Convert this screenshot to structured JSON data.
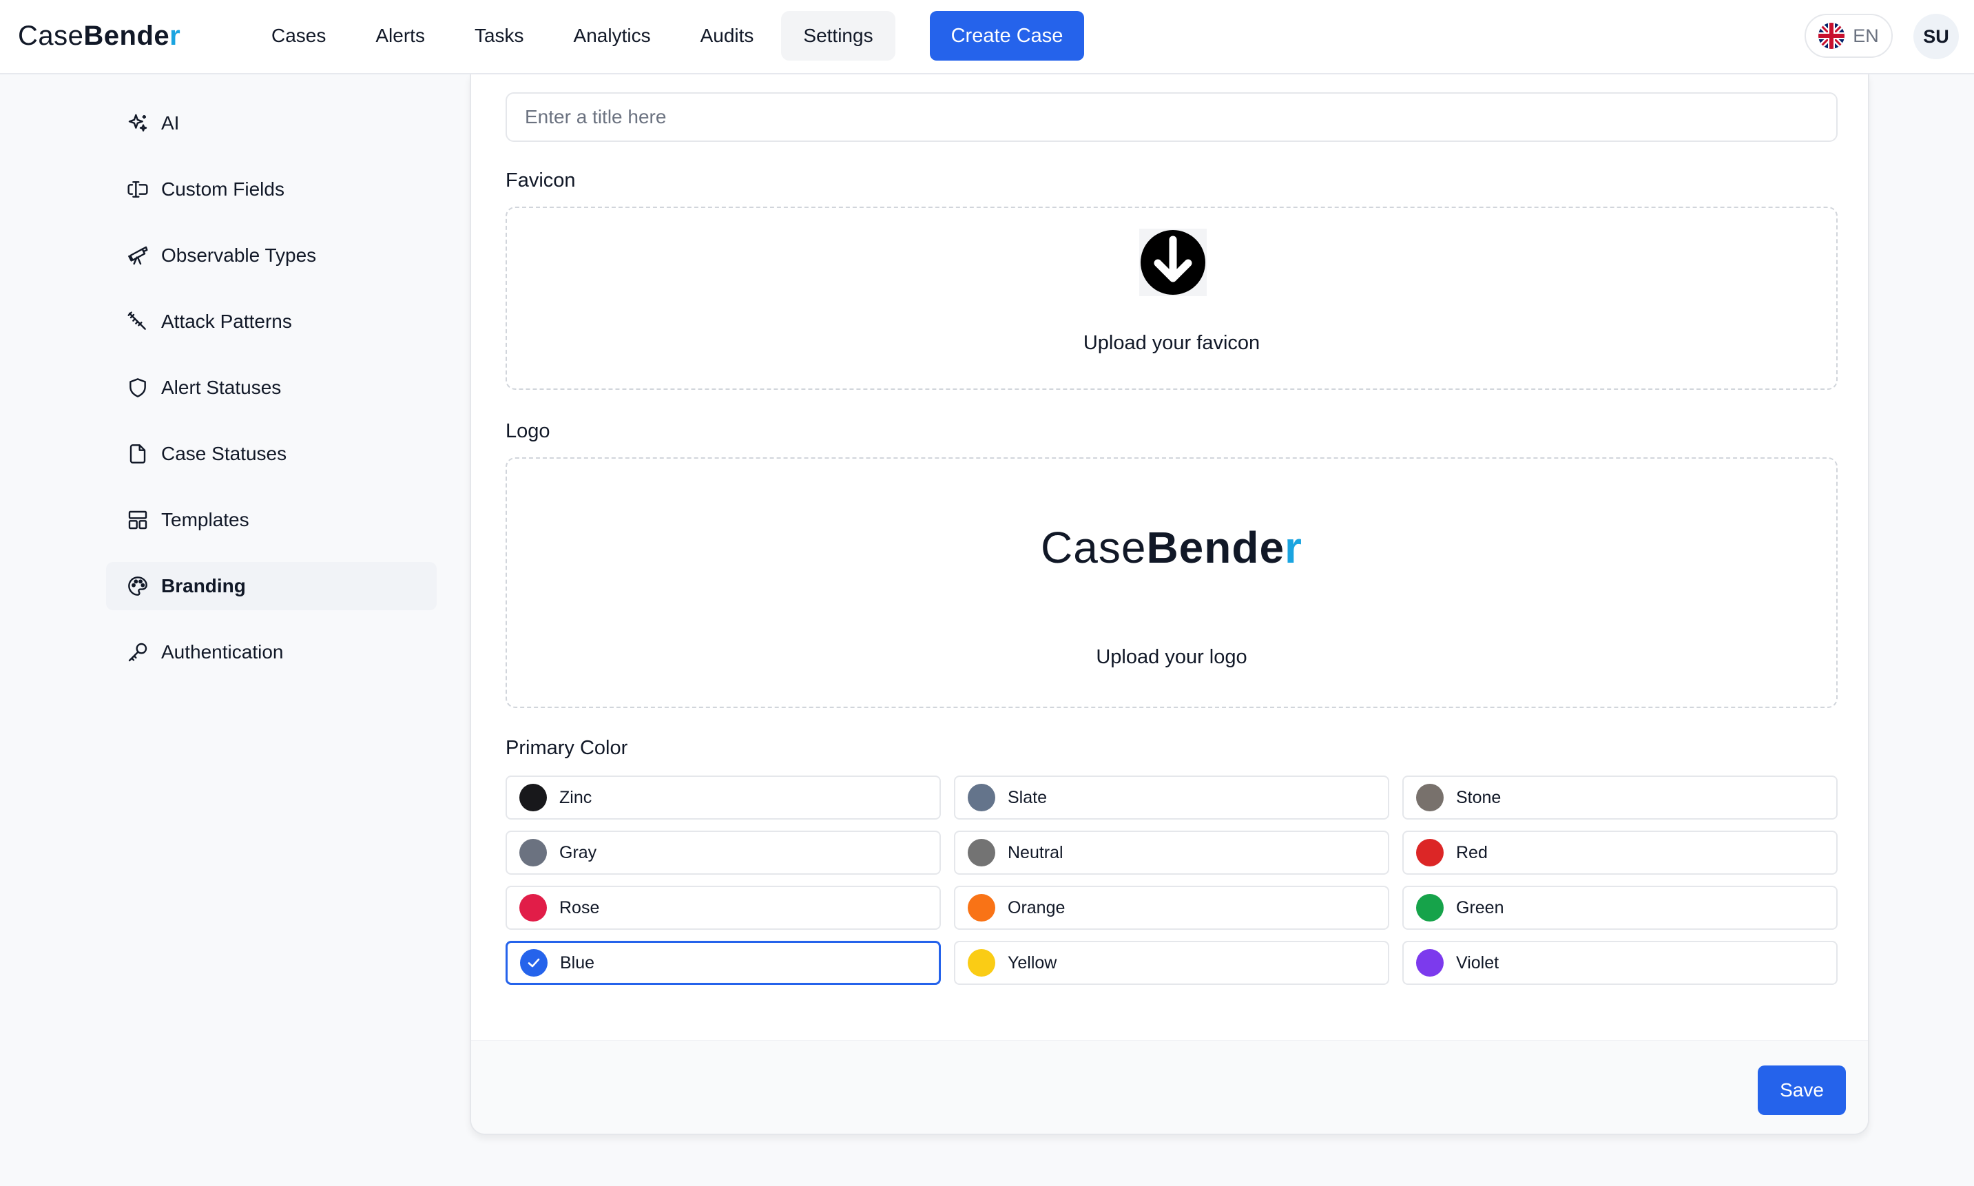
{
  "brand": {
    "case": "Case",
    "bender": "Bende",
    "arrow": "r"
  },
  "nav": {
    "items": [
      "Cases",
      "Alerts",
      "Tasks",
      "Analytics",
      "Audits",
      "Settings"
    ],
    "create_label": "Create Case"
  },
  "lang": {
    "code": "EN"
  },
  "user": {
    "initials": "SU"
  },
  "sidebar": {
    "items": [
      {
        "label": "AI",
        "icon": "sparkles-icon"
      },
      {
        "label": "Custom Fields",
        "icon": "text-cursor-input-icon"
      },
      {
        "label": "Observable Types",
        "icon": "telescope-icon"
      },
      {
        "label": "Attack Patterns",
        "icon": "syringe-icon"
      },
      {
        "label": "Alert Statuses",
        "icon": "shield-icon"
      },
      {
        "label": "Case Statuses",
        "icon": "file-icon"
      },
      {
        "label": "Templates",
        "icon": "layout-template-icon"
      },
      {
        "label": "Branding",
        "icon": "palette-icon",
        "active": true
      },
      {
        "label": "Authentication",
        "icon": "key-icon"
      }
    ]
  },
  "form": {
    "title_placeholder": "Enter a title here",
    "favicon_label": "Favicon",
    "favicon_upload": "Upload your favicon",
    "logo_label": "Logo",
    "logo_upload": "Upload your logo",
    "primary_color_label": "Primary Color",
    "colors": [
      {
        "name": "Zinc",
        "hex": "#18181b"
      },
      {
        "name": "Slate",
        "hex": "#64748b"
      },
      {
        "name": "Stone",
        "hex": "#78716c"
      },
      {
        "name": "Gray",
        "hex": "#6b7280"
      },
      {
        "name": "Neutral",
        "hex": "#737373"
      },
      {
        "name": "Red",
        "hex": "#dc2626"
      },
      {
        "name": "Rose",
        "hex": "#e11d48"
      },
      {
        "name": "Orange",
        "hex": "#f97316"
      },
      {
        "name": "Green",
        "hex": "#16a34a"
      },
      {
        "name": "Blue",
        "hex": "#2563eb",
        "selected": true
      },
      {
        "name": "Yellow",
        "hex": "#facc15"
      },
      {
        "name": "Violet",
        "hex": "#7c3aed"
      }
    ],
    "save_label": "Save"
  },
  "colors": {
    "accent": "#2563eb",
    "brand_arrow": "#1aa4e0"
  }
}
